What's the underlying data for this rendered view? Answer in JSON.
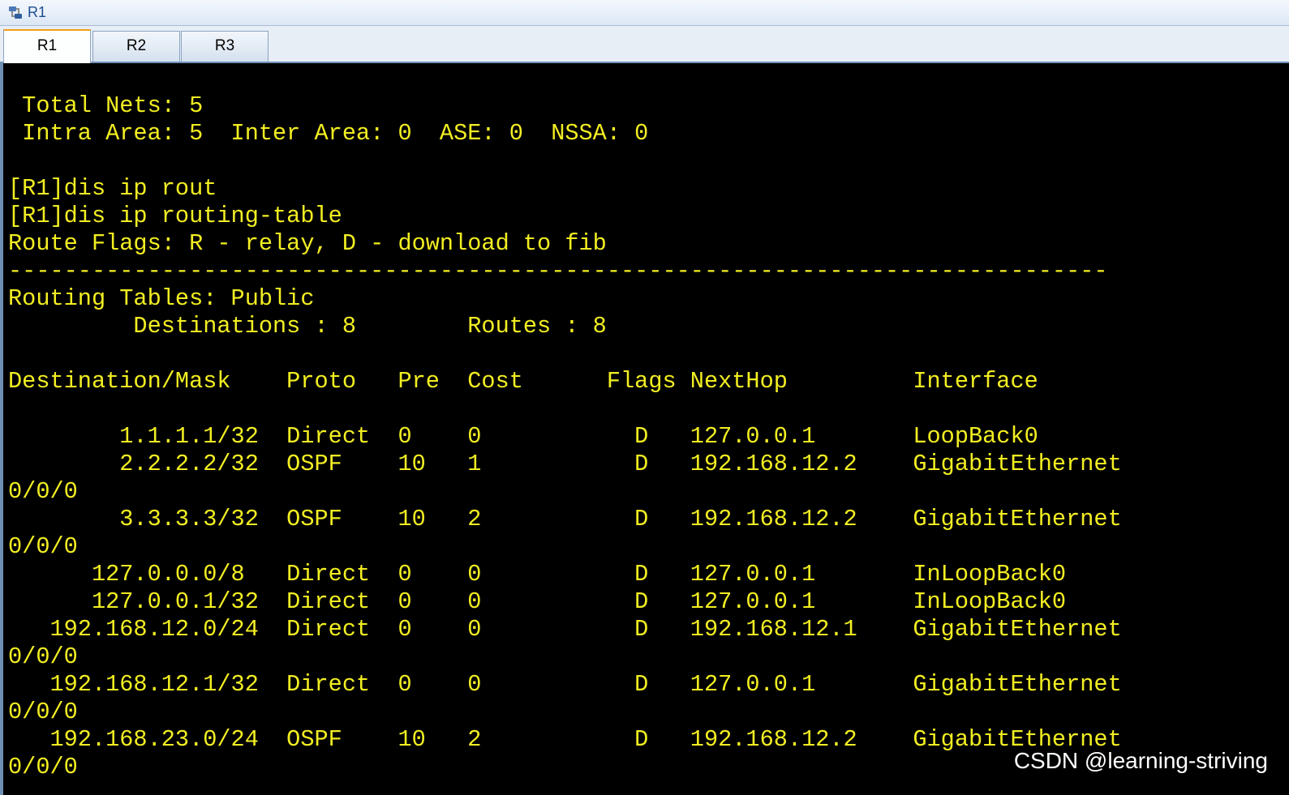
{
  "window": {
    "title": "R1",
    "icon": "router-app-icon"
  },
  "tabs": [
    {
      "label": "R1",
      "active": true
    },
    {
      "label": "R2",
      "active": false
    },
    {
      "label": "R3",
      "active": false
    }
  ],
  "terminal": {
    "text_color": "#f2ee22",
    "background": "#000000",
    "lines": [
      "",
      " Total Nets: 5",
      " Intra Area: 5  Inter Area: 0  ASE: 0  NSSA: 0",
      "",
      "[R1]dis ip rout",
      "[R1]dis ip routing-table",
      "Route Flags: R - relay, D - download to fib",
      "-------------------------------------------------------------------------------",
      "Routing Tables: Public",
      "         Destinations : 8        Routes : 8",
      "",
      "Destination/Mask    Proto   Pre  Cost      Flags NextHop         Interface",
      "",
      "        1.1.1.1/32  Direct  0    0           D   127.0.0.1       LoopBack0",
      "        2.2.2.2/32  OSPF    10   1           D   192.168.12.2    GigabitEthernet",
      "0/0/0",
      "        3.3.3.3/32  OSPF    10   2           D   192.168.12.2    GigabitEthernet",
      "0/0/0",
      "      127.0.0.0/8   Direct  0    0           D   127.0.0.1       InLoopBack0",
      "      127.0.0.1/32  Direct  0    0           D   127.0.0.1       InLoopBack0",
      "   192.168.12.0/24  Direct  0    0           D   192.168.12.1    GigabitEthernet",
      "0/0/0",
      "   192.168.12.1/32  Direct  0    0           D   127.0.0.1       GigabitEthernet",
      "0/0/0",
      "   192.168.23.0/24  OSPF    10   2           D   192.168.12.2    GigabitEthernet",
      "0/0/0"
    ]
  },
  "watermark": "CSDN @learning-striving"
}
